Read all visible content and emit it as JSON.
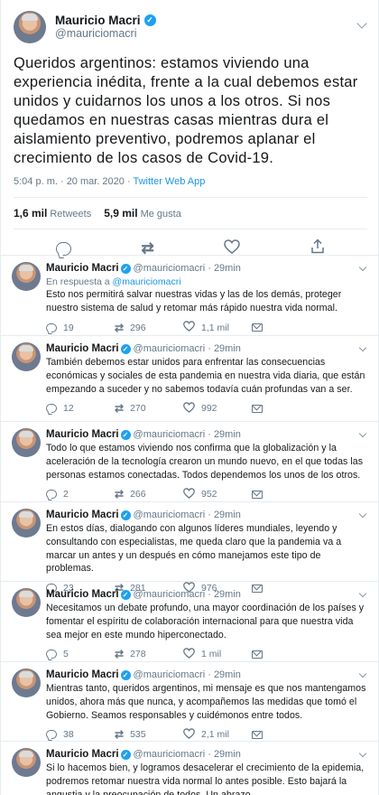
{
  "main_tweet": {
    "name": "Mauricio Macri",
    "handle": "@mauriciomacri",
    "text": "Queridos argentinos: estamos viviendo una experiencia inédita, frente a la cual debemos estar unidos y cuidarnos los unos a los otros. Si nos quedamos en nuestras casas mientras dura el aislamiento preventivo, podremos aplanar el crecimiento de los casos de Covid-19.",
    "timestamp": "5:04 p. m. · 20 mar. 2020 · ",
    "app": "Twitter Web App",
    "retweets_count": "1,6 mil",
    "retweets_label": "Retweets",
    "likes_count": "5,9 mil",
    "likes_label": "Me gusta"
  },
  "replies": [
    {
      "name": "Mauricio Macri",
      "handle": "@mauriciomacri",
      "time": "· 29min",
      "in_reply_prefix": "En respuesta a ",
      "in_reply_handle": "@mauriciomacri",
      "text": "Esto nos permitirá salvar nuestras vidas y las de los demás, proteger nuestro sistema de salud y retomar más rápido nuestra vida normal.",
      "replies": "19",
      "retweets": "296",
      "likes": "1,1 mil"
    },
    {
      "name": "Mauricio Macri",
      "handle": "@mauriciomacri",
      "time": "· 29min",
      "text": "También debemos estar unidos para enfrentar las consecuencias económicas y sociales de esta pandemia en nuestra vida diaria, que están empezando a suceder y no sabemos todavía cuán profundas van a ser.",
      "replies": "12",
      "retweets": "270",
      "likes": "992"
    },
    {
      "name": "Mauricio Macri",
      "handle": "@mauriciomacri",
      "time": "· 29min",
      "text": "Todo lo que estamos viviendo nos confirma que la globalización y la aceleración de la tecnología crearon un mundo nuevo, en el que todas las personas estamos conectadas. Todos dependemos los unos de los otros.",
      "replies": "2",
      "retweets": "266",
      "likes": "952"
    },
    {
      "name": "Mauricio Macri",
      "handle": "@mauriciomacri",
      "time": "· 29min",
      "text": "En estos días, dialogando con algunos líderes mundiales, leyendo y consultando con especialistas, me queda claro que la pandemia va a marcar un antes y un después en cómo manejamos este tipo de problemas.",
      "replies": "23",
      "retweets": "281",
      "likes": "976"
    },
    {
      "name": "Mauricio Macri",
      "handle": "@mauriciomacri",
      "time": "· 29min",
      "text": "Necesitamos un debate profundo, una mayor coordinación de los países y fomentar el espíritu de colaboración internacional para que nuestra vida sea mejor en este mundo hiperconectado.",
      "replies": "5",
      "retweets": "278",
      "likes": "1 mil"
    },
    {
      "name": "Mauricio Macri",
      "handle": "@mauriciomacri",
      "time": "· 29min",
      "text": "Mientras tanto, queridos argentinos, mi mensaje es que nos mantengamos unidos, ahora más que nunca, y acompañemos las medidas que tomó el Gobierno. Seamos responsables y cuidémonos entre todos.",
      "replies": "38",
      "retweets": "535",
      "likes": "2,1 mil"
    },
    {
      "name": "Mauricio Macri",
      "handle": "@mauriciomacri",
      "time": "· 29min",
      "text": "Si lo hacemos bien, y logramos desacelerar el crecimiento de la epidemia, podremos retomar nuestra vida normal lo antes posible. Esto bajará la angustia y la preocupación de todos. Un abrazo."
    }
  ],
  "icons": {
    "verified": "verified-badge-icon",
    "reply": "reply-icon",
    "retweet": "retweet-icon",
    "like": "heart-icon",
    "share": "share-icon",
    "dm": "mail-icon",
    "more": "chevron-down-icon"
  },
  "colors": {
    "accent": "#1da1f2",
    "link": "#1b95e0",
    "secondary_text": "#657786"
  }
}
